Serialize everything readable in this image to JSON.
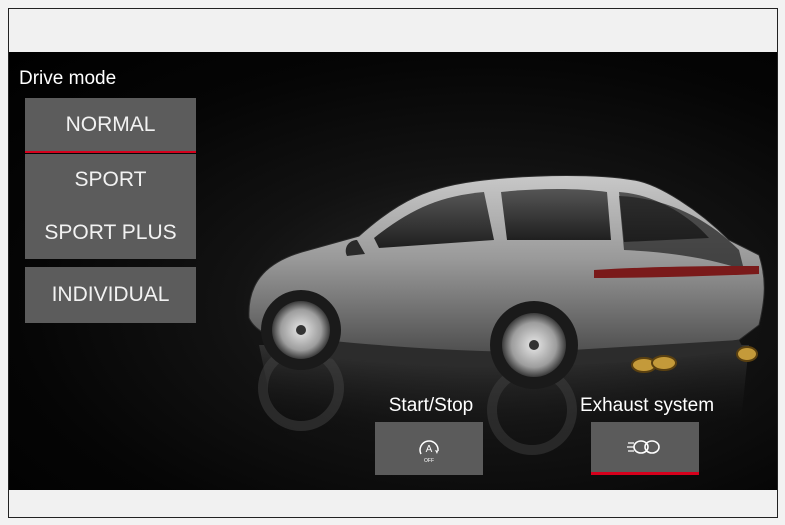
{
  "drive_mode": {
    "title": "Drive mode",
    "options": [
      "NORMAL",
      "SPORT",
      "SPORT PLUS",
      "INDIVIDUAL"
    ],
    "selected": "NORMAL"
  },
  "controls": {
    "start_stop": {
      "label": "Start/Stop",
      "icon": "auto-start-stop-off-icon",
      "icon_text_main": "A",
      "icon_text_sub": "OFF"
    },
    "exhaust": {
      "label": "Exhaust system",
      "icon": "sport-exhaust-icon",
      "active": true
    }
  },
  "colors": {
    "accent": "#d5001c",
    "button": "#5c5c5c",
    "text": "#ffffff"
  }
}
